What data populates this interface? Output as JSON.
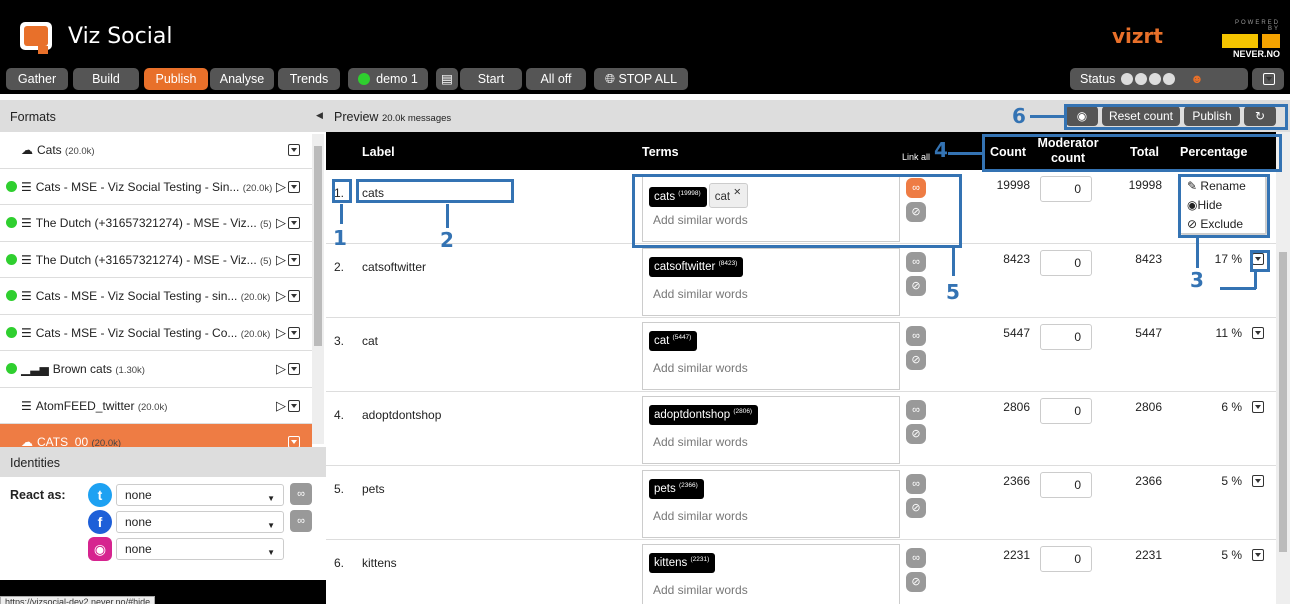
{
  "app": {
    "title": "Viz Social",
    "brand": "vizrt",
    "powered_by": "POWERED BY",
    "partner": "NEVER.NO"
  },
  "nav": {
    "tabs": [
      "Gather",
      "Build",
      "Publish",
      "Analyse",
      "Trends"
    ],
    "active_tab": "Publish",
    "profile": "demo 1",
    "start": "Start",
    "all_off": "All off",
    "stop_all": "STOP ALL",
    "status": "Status"
  },
  "formats": {
    "title": "Formats",
    "items": [
      {
        "name": "Cats",
        "count": "(20.0k)",
        "icon": "cloud-icon",
        "live": false,
        "play": false
      },
      {
        "name": "Cats - MSE - Viz Social Testing - Sin...",
        "count": "(20.0k)",
        "icon": "list-icon",
        "live": true,
        "play": true
      },
      {
        "name": "The Dutch (+31657321274) - MSE - Viz...",
        "count": "(5)",
        "icon": "list-icon",
        "live": true,
        "play": true
      },
      {
        "name": "The Dutch (+31657321274) - MSE - Viz...",
        "count": "(5)",
        "icon": "list-icon",
        "live": true,
        "play": true
      },
      {
        "name": "Cats - MSE - Viz Social Testing - sin...",
        "count": "(20.0k)",
        "icon": "list-icon",
        "live": true,
        "play": true
      },
      {
        "name": "Cats - MSE - Viz Social Testing - Co...",
        "count": "(20.0k)",
        "icon": "list-icon",
        "live": true,
        "play": true
      },
      {
        "name": "Brown cats",
        "count": "(1.30k)",
        "icon": "chart-icon",
        "live": true,
        "play": true
      },
      {
        "name": "AtomFEED_twitter",
        "count": "(20.0k)",
        "icon": "list-icon",
        "live": false,
        "play": true
      },
      {
        "name": "CATS_00",
        "count": "(20.0k)",
        "icon": "cloud-icon",
        "live": false,
        "play": false
      }
    ]
  },
  "identities": {
    "title": "Identities",
    "react_as": "React as:",
    "accounts": [
      {
        "network": "twitter-icon",
        "value": "none"
      },
      {
        "network": "facebook-icon",
        "value": "none"
      },
      {
        "network": "instagram-icon",
        "value": "none"
      }
    ]
  },
  "url_tooltip": "https://vizsocial-dev2.never.no/#hide",
  "preview": {
    "title": "Preview",
    "subtitle": "20.0k messages",
    "buttons": {
      "reset": "Reset count",
      "publish": "Publish"
    }
  },
  "table": {
    "headers": {
      "label": "Label",
      "terms": "Terms",
      "link_all": "Link all",
      "count": "Count",
      "moderator": "Moderator",
      "moderator2": "count",
      "total": "Total",
      "percentage": "Percentage"
    },
    "similar_placeholder": "Add similar words",
    "rows": [
      {
        "num": "1.",
        "label": "cats",
        "term": "cats",
        "term_count": "(19998)",
        "extra_term": "cat",
        "count": "19998",
        "moderator": "0",
        "total": "19998",
        "pct": ""
      },
      {
        "num": "2.",
        "label": "catsoftwitter",
        "term": "catsoftwitter",
        "term_count": "(8423)",
        "count": "8423",
        "moderator": "0",
        "total": "8423",
        "pct": "17 %"
      },
      {
        "num": "3.",
        "label": "cat",
        "term": "cat",
        "term_count": "(5447)",
        "count": "5447",
        "moderator": "0",
        "total": "5447",
        "pct": "11 %"
      },
      {
        "num": "4.",
        "label": "adoptdontshop",
        "term": "adoptdontshop",
        "term_count": "(2806)",
        "count": "2806",
        "moderator": "0",
        "total": "2806",
        "pct": "6 %"
      },
      {
        "num": "5.",
        "label": "pets",
        "term": "pets",
        "term_count": "(2366)",
        "count": "2366",
        "moderator": "0",
        "total": "2366",
        "pct": "5 %"
      },
      {
        "num": "6.",
        "label": "kittens",
        "term": "kittens",
        "term_count": "(2231)",
        "count": "2231",
        "moderator": "0",
        "total": "2231",
        "pct": "5 %"
      }
    ]
  },
  "menu": {
    "rename": "Rename",
    "hide": "Hide",
    "exclude": "Exclude"
  },
  "annotations": [
    "1",
    "2",
    "3",
    "4",
    "5",
    "6"
  ],
  "colors": {
    "accent": "#e8702a",
    "annotation": "#3473b3",
    "live": "#2fcf2f"
  }
}
